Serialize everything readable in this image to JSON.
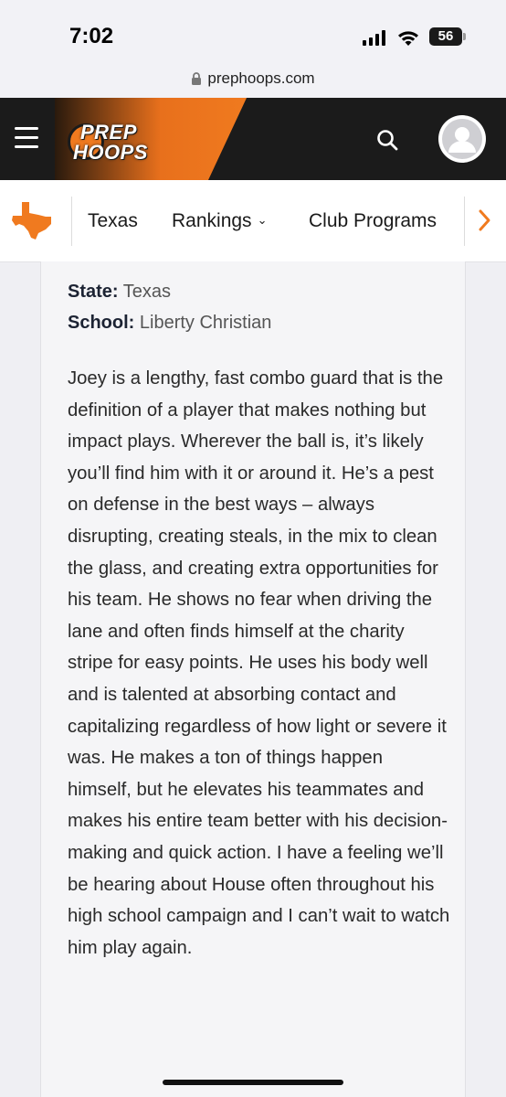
{
  "status_bar": {
    "time": "7:02",
    "battery": "56",
    "icons": [
      "signal-icon",
      "wifi-icon",
      "battery-icon"
    ]
  },
  "browser": {
    "url": "prephoops.com"
  },
  "header": {
    "logo_line1": "PREP",
    "logo_line2": "HOOPS",
    "colors": {
      "bar": "#1b1b1b",
      "accent": "#f07a1f"
    },
    "icons": [
      "menu-icon",
      "search-icon",
      "avatar-icon"
    ]
  },
  "nav": {
    "items": [
      {
        "label": "Texas"
      },
      {
        "label": "Rankings",
        "has_dropdown": true
      },
      {
        "label": "Club Programs"
      }
    ],
    "icons": [
      "texas-state-icon",
      "chevron-right-icon"
    ],
    "accent": "#f07a1f"
  },
  "profile": {
    "state_label": "State:",
    "state_value": "Texas",
    "school_label": "School:",
    "school_value": "Liberty Christian",
    "bio": "Joey is a lengthy, fast combo guard that is the definition of a player that makes nothing but impact plays. Wherever the ball is, it’s likely you’ll find him with it or around it. He’s a pest on defense in the best ways – always disrupting, creating steals, in the mix to clean the glass, and creating extra opportunities for his team. He shows no fear when driving the lane and often finds himself at the charity stripe for easy points. He uses his body well and is talented at absorbing contact and capitalizing regardless of how light or severe it was. He makes a ton of things happen himself, but he elevates his teammates and makes his entire team better with his decision-making and quick action. I have a feeling we’ll be hearing about House often throughout his high school campaign and I can’t wait to watch him play again."
  }
}
